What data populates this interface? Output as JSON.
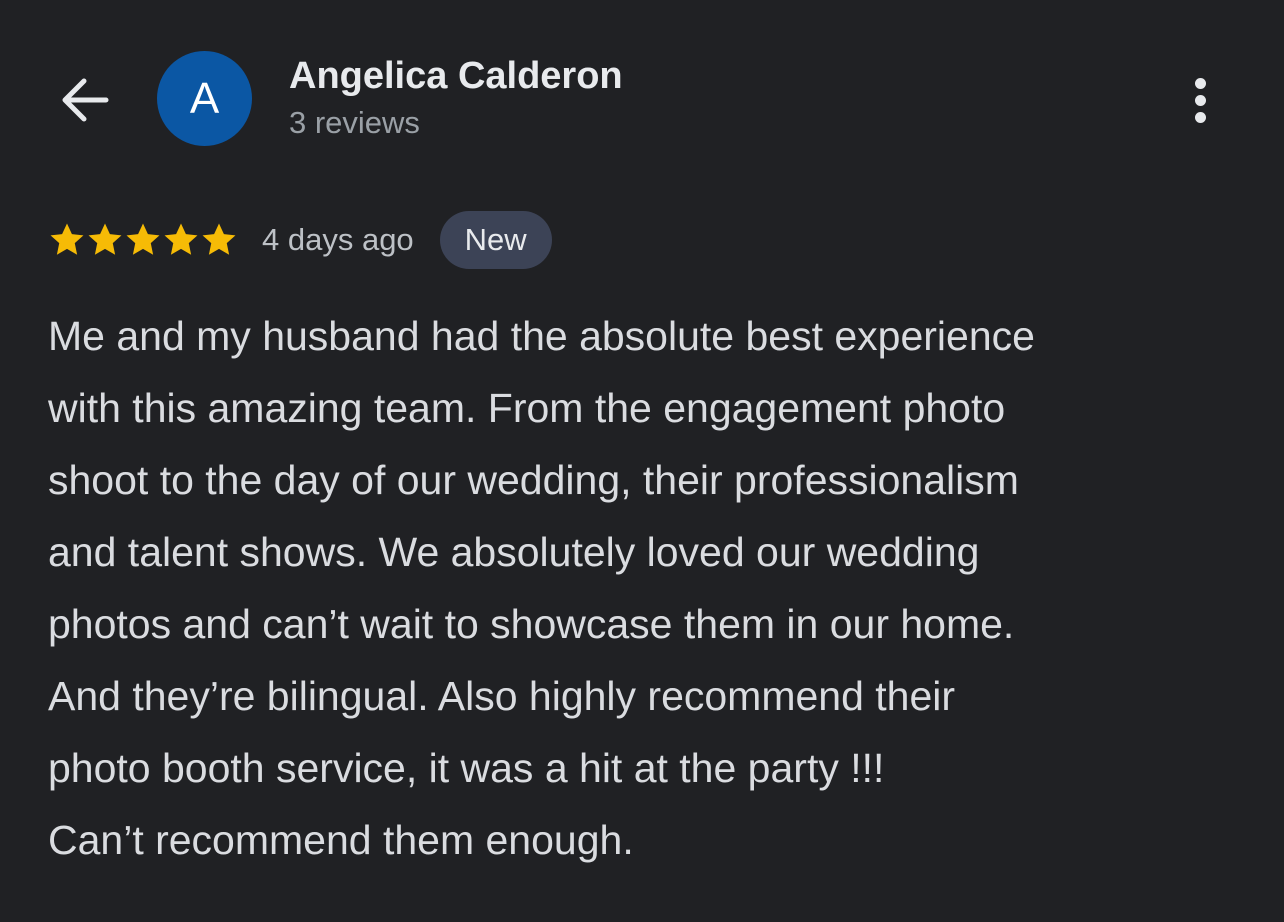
{
  "header": {
    "back_icon": "arrow-left-icon",
    "avatar_letter": "A",
    "reviewer_name": "Angelica Calderon",
    "review_count": "3 reviews",
    "more_icon": "more-vertical-icon"
  },
  "review": {
    "rating": 5,
    "rating_max": 5,
    "date": "4 days ago",
    "badge": "New",
    "text": "Me and my husband had the absolute best experience\nwith this amazing team. From the engagement photo\nshoot to the day of our wedding, their professionalism\nand talent shows. We absolutely loved our wedding\nphotos and can’t wait to showcase them in our home.\nAnd they’re bilingual. Also highly recommend their\nphoto booth service, it was a hit at the party !!!\nCan’t recommend them enough."
  },
  "colors": {
    "background": "#202124",
    "avatar": "#0b57a4",
    "star": "#f6bb06",
    "badge_bg": "#3c4356"
  }
}
